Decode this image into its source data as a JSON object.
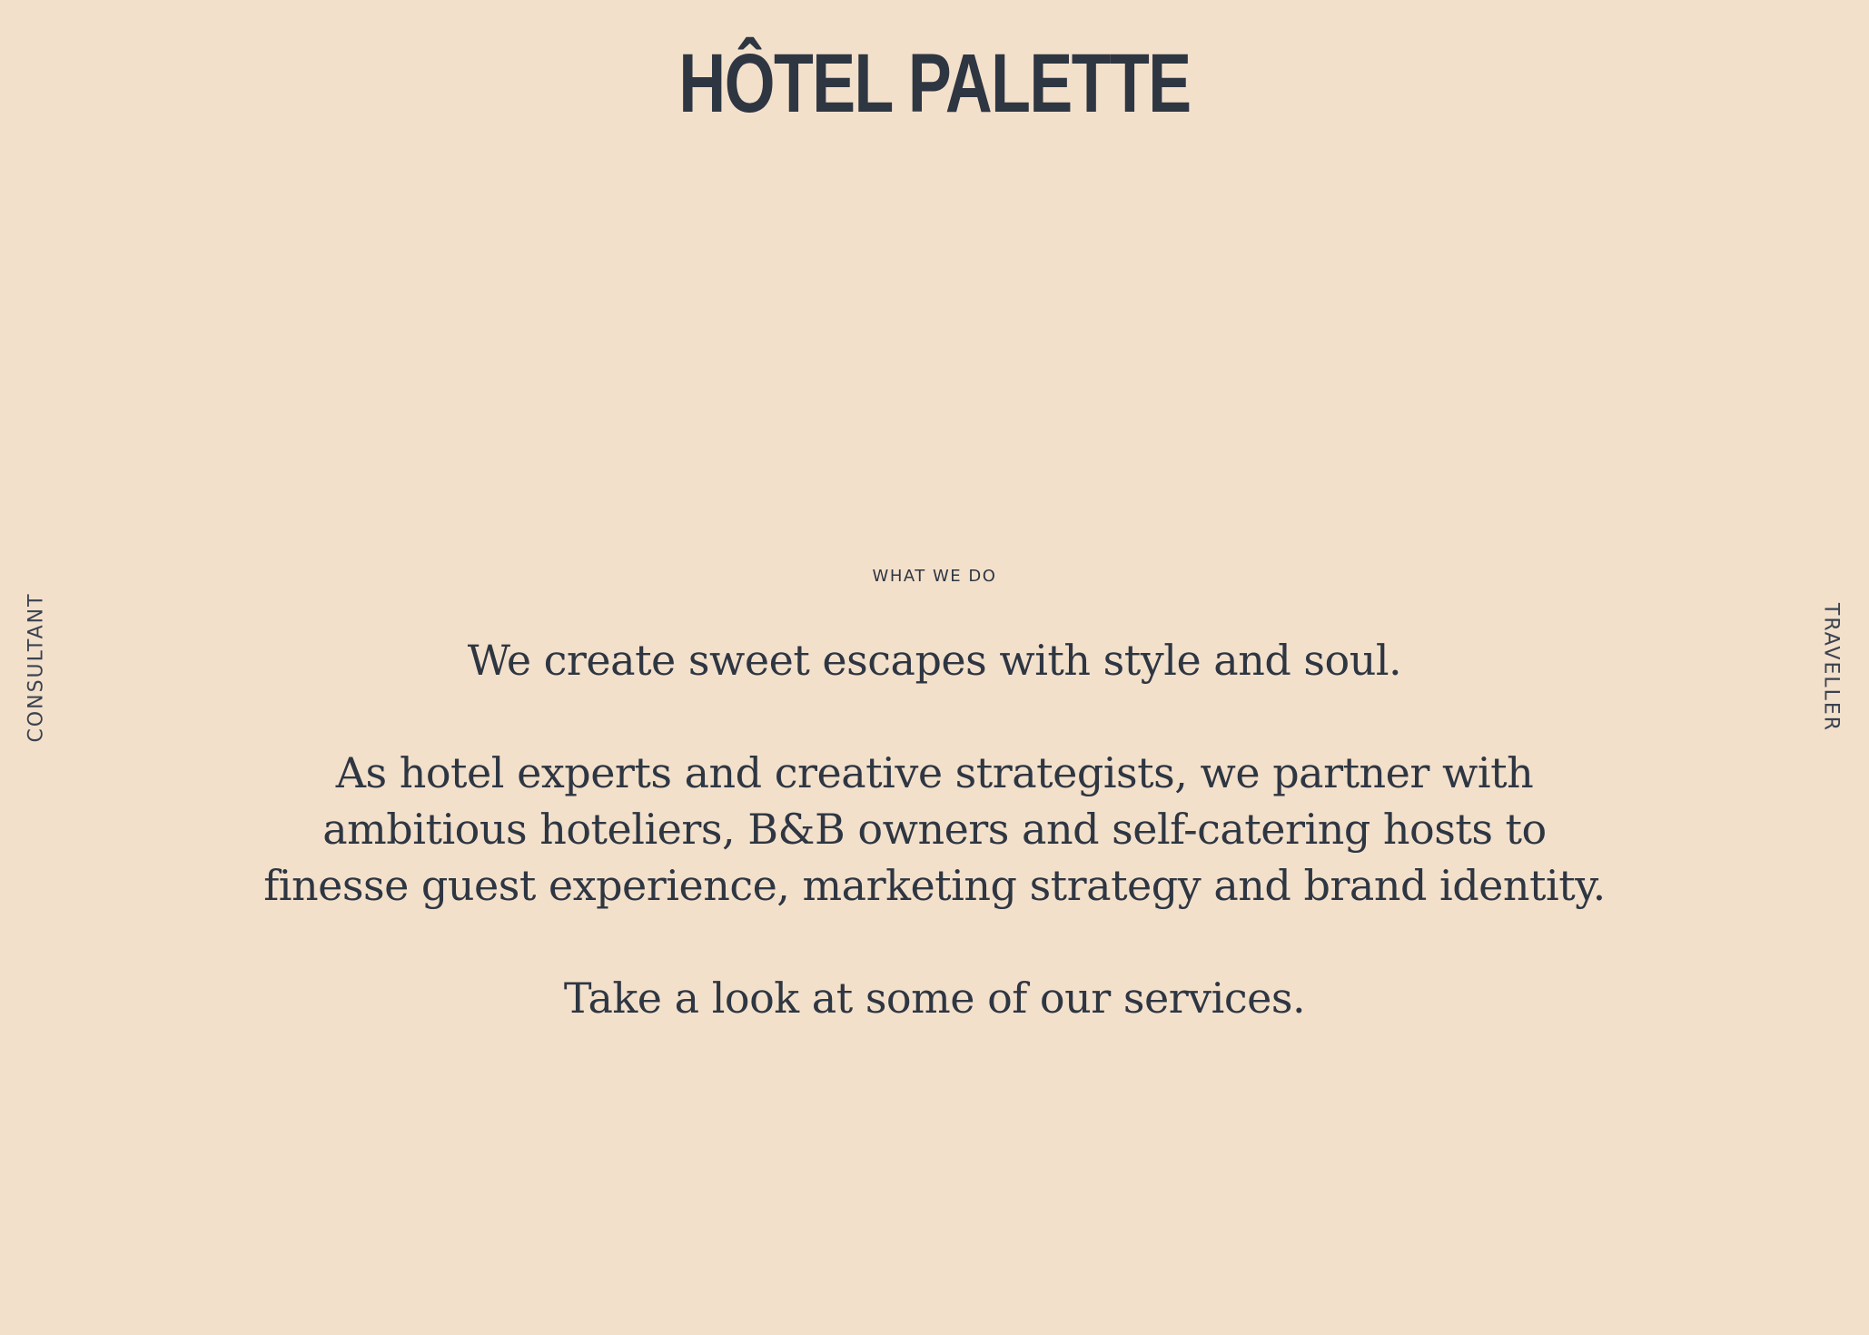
{
  "header": {
    "logo_text": "HÔTEL PALETTE"
  },
  "side_nav": {
    "left_label": "CONSULTANT",
    "right_label": "TRAVELLER"
  },
  "main": {
    "eyebrow": "WHAT WE DO",
    "paragraphs": [
      "We create sweet escapes with style and soul.",
      "As hotel experts and creative strategists, we partner with ambitious hoteliers, B&B owners and self-catering hosts to finesse guest experience, marketing strategy and brand identity.",
      "Take a look at some of our services."
    ]
  },
  "colors": {
    "background": "#f3e0cb",
    "text": "#2e3642"
  }
}
